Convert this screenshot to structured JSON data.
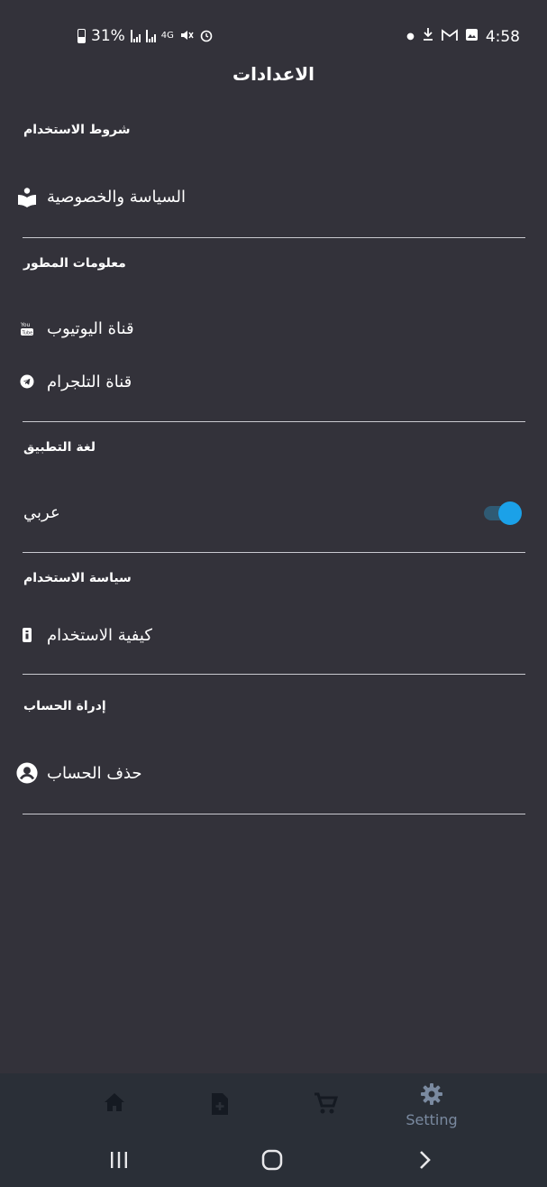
{
  "status": {
    "battery": "31%",
    "network": "4G",
    "time": "4:58"
  },
  "header": {
    "title": "الاعدادات"
  },
  "sections": {
    "terms": {
      "title": "شروط الاستخدام",
      "items": [
        {
          "label": "السياسة والخصوصية",
          "icon": "privacy-book-icon"
        }
      ]
    },
    "developer": {
      "title": "معلومات المطور",
      "items": [
        {
          "label": "قناة اليوتيوب",
          "icon": "youtube-icon"
        },
        {
          "label": "قناة التلجرام",
          "icon": "telegram-icon"
        }
      ]
    },
    "language": {
      "title": "لغة التطبيق",
      "items": [
        {
          "label": "عربي",
          "toggle": true
        }
      ]
    },
    "usage": {
      "title": "سياسة الاستخدام",
      "items": [
        {
          "label": "كيفية الاستخدام",
          "icon": "info-icon"
        }
      ]
    },
    "account": {
      "title": "إدراة الحساب",
      "items": [
        {
          "label": "حذف الحساب",
          "icon": "account-circle-icon"
        }
      ]
    }
  },
  "bottom_nav": {
    "items": [
      {
        "icon": "home-icon"
      },
      {
        "icon": "add-file-icon"
      },
      {
        "icon": "cart-icon"
      },
      {
        "icon": "gear-icon",
        "label": "Setting"
      }
    ]
  },
  "colors": {
    "background": "#33323a",
    "nav_background": "#2a2f37",
    "accent": "#1ba1e8",
    "nav_active": "#7a8aa0"
  }
}
